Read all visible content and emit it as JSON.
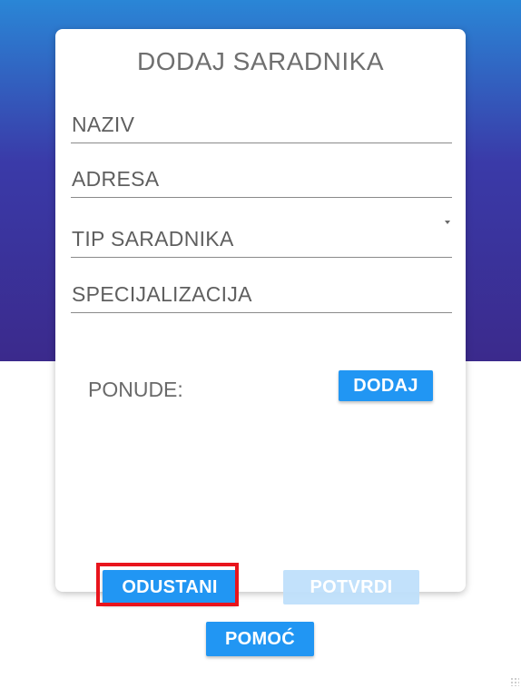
{
  "form": {
    "title": "DODAJ SARADNIKA",
    "fields": {
      "naziv": {
        "label": "NAZIV",
        "value": ""
      },
      "adresa": {
        "label": "ADRESA",
        "value": ""
      },
      "tip_saradnika": {
        "label": "TIP SARADNIKA",
        "value": "",
        "icon": "dropdown-caret-icon"
      },
      "specijalizacija": {
        "label": "SPECIJALIZACIJA",
        "value": ""
      }
    },
    "ponude_label": "PONUDE:",
    "dodaj_label": "DODAJ"
  },
  "actions": {
    "odustani_label": "ODUSTANI",
    "potvrdi_label": "POTVRDI",
    "pomoc_label": "POMOĆ"
  },
  "colors": {
    "primary_button": "#2196f3",
    "disabled_button": "#bfe0fb",
    "highlight_border": "#e8141c",
    "gradient_top": "#2a86d6",
    "gradient_bottom": "#3b2a8c"
  }
}
